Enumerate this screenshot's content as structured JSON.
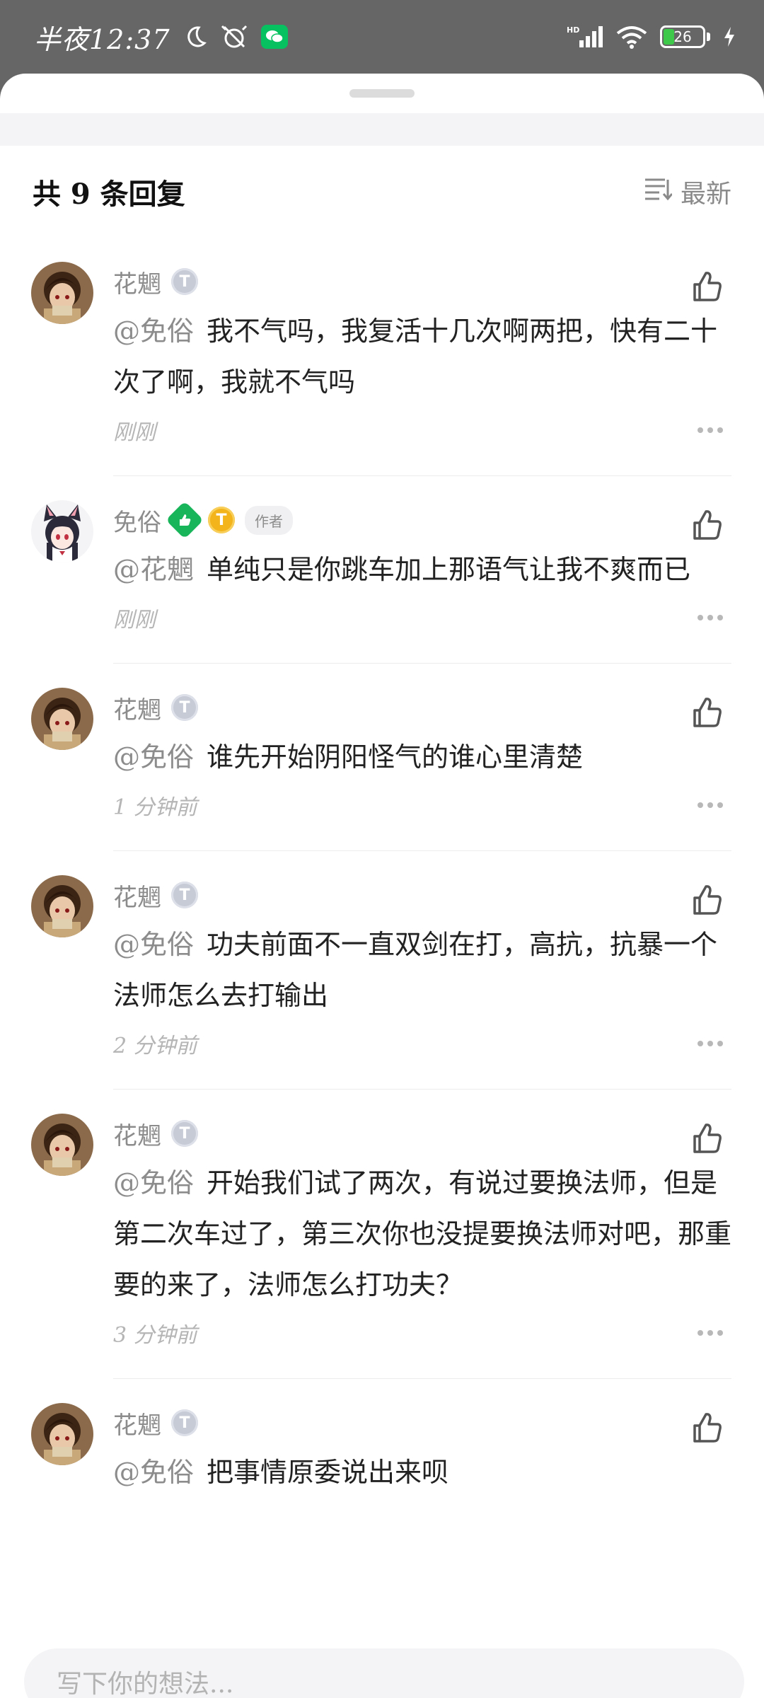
{
  "status_bar": {
    "time": "半夜12:37",
    "network": "HD",
    "battery": "26"
  },
  "header": {
    "title": "共 9 条回复",
    "sort_label": "最新"
  },
  "comments": [
    {
      "name": "花魍",
      "badge": "T",
      "mention": "@免俗",
      "text": "我不气吗，我复活十几次啊两把，快有二十次了啊，我就不气吗",
      "time": "刚刚",
      "avatar": "boy"
    },
    {
      "name": "免俗",
      "badge": "T",
      "author_tag": "作者",
      "mention": "@花魍",
      "text": "单纯只是你跳车加上那语气让我不爽而已",
      "time": "刚刚",
      "avatar": "girl"
    },
    {
      "name": "花魍",
      "badge": "T",
      "mention": "@免俗",
      "text": "谁先开始阴阳怪气的谁心里清楚",
      "time": "1 分钟前",
      "avatar": "boy"
    },
    {
      "name": "花魍",
      "badge": "T",
      "mention": "@免俗",
      "text": "功夫前面不一直双剑在打，高抗，抗暴一个法师怎么去打输出",
      "time": "2 分钟前",
      "avatar": "boy"
    },
    {
      "name": "花魍",
      "badge": "T",
      "mention": "@免俗",
      "text": "开始我们试了两次，有说过要换法师，但是第二次车过了，第三次你也没提要换法师对吧，那重要的来了，法师怎么打功夫？",
      "time": "3 分钟前",
      "avatar": "boy"
    },
    {
      "name": "花魍",
      "badge": "T",
      "mention": "@免俗",
      "text": "把事情原委说出来呗",
      "time": "",
      "avatar": "boy"
    }
  ],
  "input": {
    "placeholder": "写下你的想法..."
  },
  "colors": {
    "status_bg": "#666666",
    "accent_green": "#19b55b",
    "badge_gold": "#f3b41b"
  }
}
